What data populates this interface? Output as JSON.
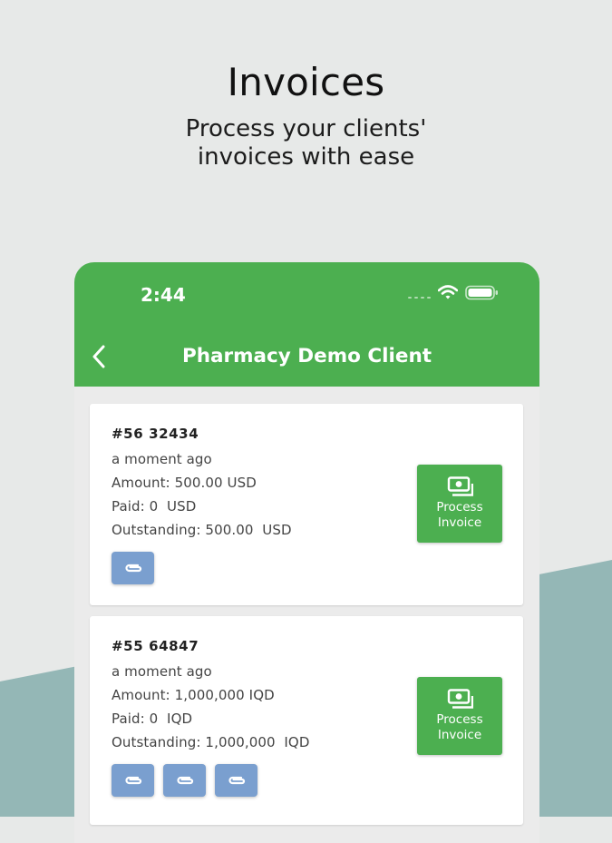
{
  "promo": {
    "title": "Invoices",
    "subtitle": "Process your clients' invoices with ease"
  },
  "status_bar": {
    "time": "2:44",
    "icons": [
      "signal-dots-icon",
      "wifi-icon",
      "battery-icon"
    ]
  },
  "app_bar": {
    "title": "Pharmacy Demo Client",
    "back_icon": "chevron-left-icon"
  },
  "invoices": [
    {
      "number": "#56 32434",
      "time": "a moment ago",
      "amount": "Amount: 500.00 USD",
      "paid": "Paid: 0  USD",
      "outstanding": "Outstanding: 500.00  USD",
      "process_label_1": "Process",
      "process_label_2": "Invoice",
      "attachments": 1
    },
    {
      "number": "#55 64847",
      "time": "a moment ago",
      "amount": "Amount: 1,000,000 IQD",
      "paid": "Paid: 0  IQD",
      "outstanding": "Outstanding: 1,000,000  IQD",
      "process_label_1": "Process",
      "process_label_2": "Invoice",
      "attachments": 3
    }
  ],
  "colors": {
    "primary_green": "#4caf50",
    "attachment_blue": "#7a9fcf",
    "page_background": "#e7e9e8",
    "accent_teal": "#94b7b6"
  }
}
